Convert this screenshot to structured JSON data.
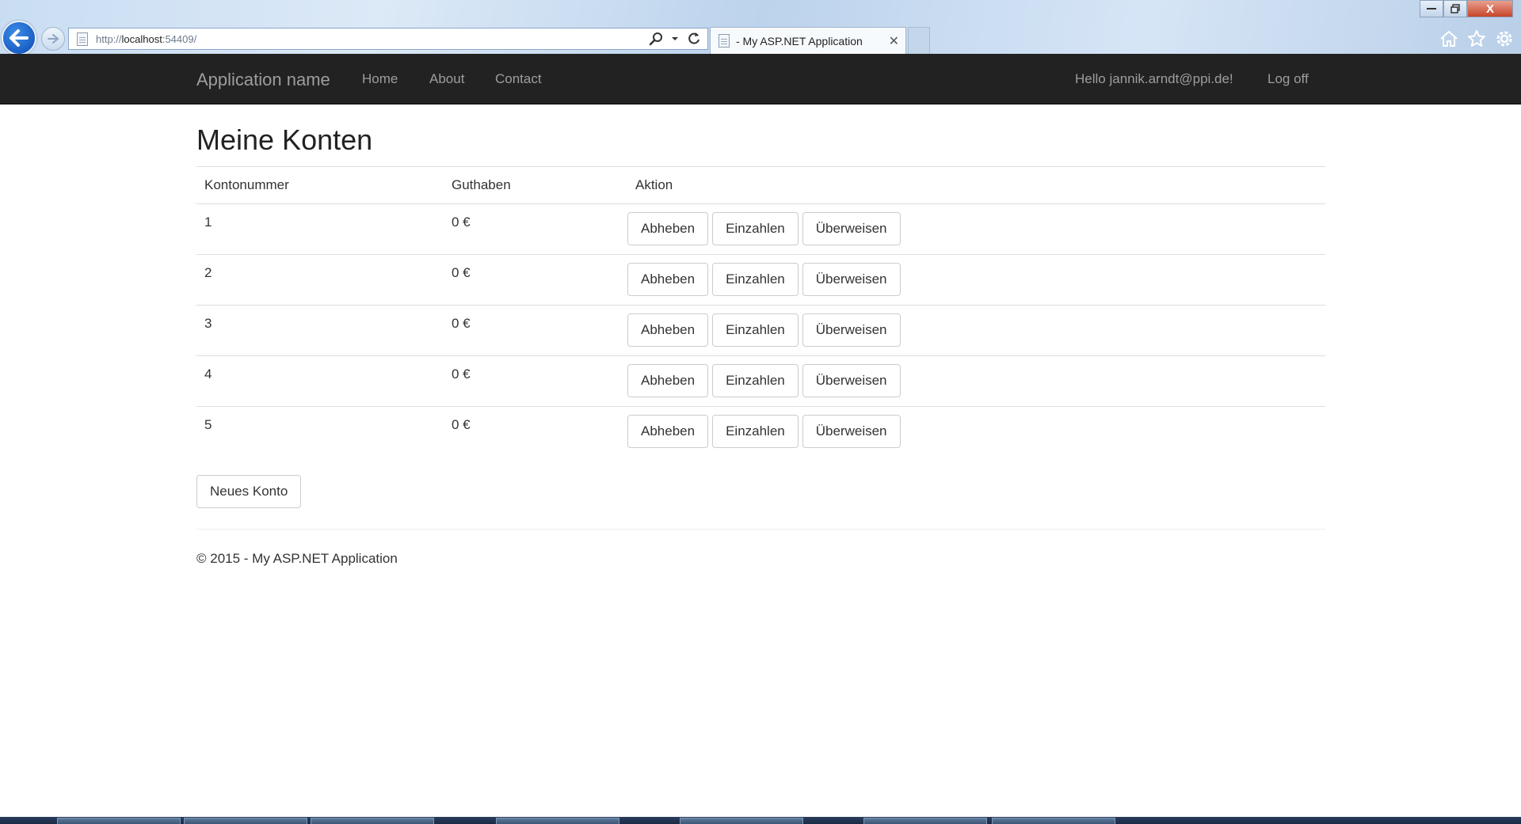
{
  "browser": {
    "url_prefix": "http://",
    "url_host": "localhost",
    "url_rest": ":54409/",
    "tab_title": "- My ASP.NET Application",
    "win_close_label": "X"
  },
  "navbar": {
    "brand": "Application name",
    "links": [
      {
        "label": "Home"
      },
      {
        "label": "About"
      },
      {
        "label": "Contact"
      }
    ],
    "greeting": "Hello jannik.arndt@ppi.de!",
    "logoff": "Log off"
  },
  "page": {
    "title": "Meine Konten",
    "columns": [
      "Kontonummer",
      "Guthaben",
      "Aktion"
    ],
    "action_labels": {
      "withdraw": "Abheben",
      "deposit": "Einzahlen",
      "transfer": "Überweisen"
    },
    "rows": [
      {
        "number": "1",
        "balance": "0 €"
      },
      {
        "number": "2",
        "balance": "0 €"
      },
      {
        "number": "3",
        "balance": "0 €"
      },
      {
        "number": "4",
        "balance": "0 €"
      },
      {
        "number": "5",
        "balance": "0 €"
      }
    ],
    "new_account_label": "Neues Konto"
  },
  "footer": {
    "text": "© 2015 - My ASP.NET Application"
  },
  "colors": {
    "navbar_bg": "#222222",
    "nav_text": "#9d9d9d",
    "browser_back": "#1a5fc4"
  }
}
